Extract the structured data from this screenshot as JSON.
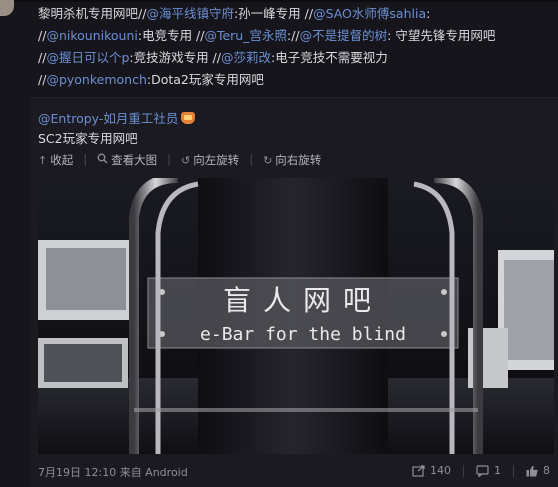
{
  "repost": {
    "lines": [
      {
        "segments": [
          {
            "t": "黎明杀机专用网吧//",
            "u": false
          },
          {
            "t": "@海平线镇守府",
            "u": true
          },
          {
            "t": ":孙一峰专用 //",
            "u": false
          },
          {
            "t": "@SAO水师傅sahlia",
            "u": true
          },
          {
            "t": ":",
            "u": false
          }
        ]
      },
      {
        "segments": [
          {
            "t": "//",
            "u": false
          },
          {
            "t": "@nikounikouni",
            "u": true
          },
          {
            "t": ":电竞专用 //",
            "u": false
          },
          {
            "t": "@Teru_宫永照",
            "u": true
          },
          {
            "t": "://",
            "u": false
          },
          {
            "t": "@不是提督的树",
            "u": true
          },
          {
            "t": ": 守望先锋专用网吧",
            "u": false
          }
        ]
      },
      {
        "segments": [
          {
            "t": "//",
            "u": false
          },
          {
            "t": "@握日可以个p",
            "u": true
          },
          {
            "t": ":竞技游戏专用 //",
            "u": false
          },
          {
            "t": "@莎莉改",
            "u": true
          },
          {
            "t": ":电子竞技不需要视力",
            "u": false
          }
        ]
      },
      {
        "segments": [
          {
            "t": "//",
            "u": false
          },
          {
            "t": "@pyonkemonch",
            "u": true
          },
          {
            "t": ":Dota2玩家专用网吧",
            "u": false
          }
        ]
      }
    ]
  },
  "original": {
    "author": "@Entropy-如月重工社员",
    "text": "SC2玩家专用网吧",
    "actions": [
      {
        "label": "收起",
        "icon": "collapse-icon",
        "glyph": "↑"
      },
      {
        "label": "查看大图",
        "icon": "zoom-icon",
        "glyph": "🔍"
      },
      {
        "label": "向左旋转",
        "icon": "rotate-left-icon",
        "glyph": "↺"
      },
      {
        "label": "向右旋转",
        "icon": "rotate-right-icon",
        "glyph": "↻"
      }
    ],
    "photo": {
      "sign_cn": "盲人网吧",
      "sign_en": "e-Bar for the blind"
    }
  },
  "footer": {
    "time": "7月19日 12:10 来自 Android",
    "reposts": "140",
    "comments": "1",
    "likes": "8"
  },
  "colors": {
    "link": "#6b8fd3",
    "background": "#16151b"
  }
}
